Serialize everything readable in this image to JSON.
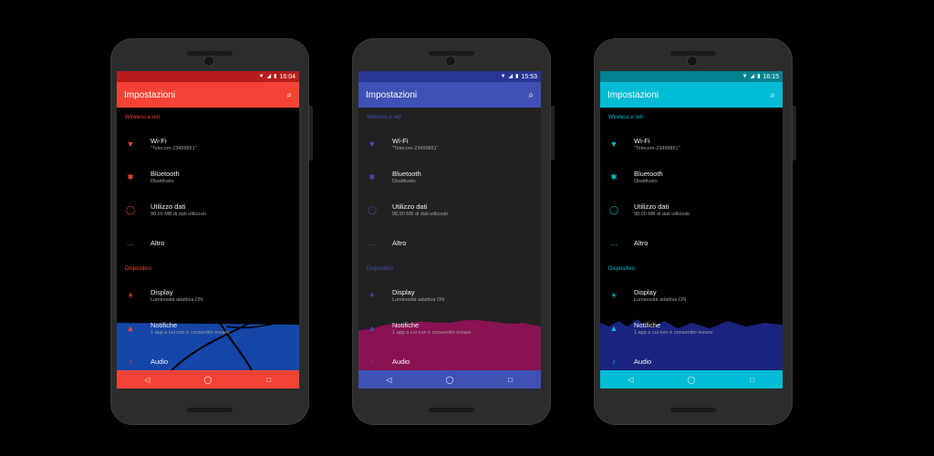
{
  "phones": [
    {
      "time": "16:04",
      "title": "Impostazioni",
      "accent": "#f44336",
      "accent_dark": "#b71c1c",
      "bg": "#000000",
      "sections": [
        "Wireless e reti",
        "Dispositivo"
      ],
      "items": [
        {
          "title": "Wi-Fi",
          "subtitle": "\"Telecom-23499851\"",
          "icon": "wifi-icon"
        },
        {
          "title": "Bluetooth",
          "subtitle": "Disattivato",
          "icon": "bluetooth-icon"
        },
        {
          "title": "Utilizzo dati",
          "subtitle": "98,90 MB di dati utilizzati",
          "icon": "data-usage-icon"
        },
        {
          "title": "Altro",
          "subtitle": "",
          "icon": "more-icon"
        },
        {
          "title": "Display",
          "subtitle": "Luminosità adattiva ON",
          "icon": "brightness-icon"
        },
        {
          "title": "Notifiche",
          "subtitle": "1 app a cui non è consentito inviare",
          "icon": "bell-icon"
        },
        {
          "title": "Audio",
          "subtitle": "",
          "icon": "audio-icon"
        }
      ],
      "wave_color": "#1546a8"
    },
    {
      "time": "15:53",
      "title": "Impostazioni",
      "accent": "#3f51b5",
      "accent_dark": "#283593",
      "bg": "#212121",
      "sections": [
        "Wireless e reti",
        "Dispositivo"
      ],
      "items": [
        {
          "title": "Wi-Fi",
          "subtitle": "\"Telecom-23499851\"",
          "icon": "wifi-icon"
        },
        {
          "title": "Bluetooth",
          "subtitle": "Disattivato",
          "icon": "bluetooth-icon"
        },
        {
          "title": "Utilizzo dati",
          "subtitle": "98,90 MB di dati utilizzati",
          "icon": "data-usage-icon"
        },
        {
          "title": "Altro",
          "subtitle": "",
          "icon": "more-icon"
        },
        {
          "title": "Display",
          "subtitle": "Luminosità adattiva ON",
          "icon": "brightness-icon"
        },
        {
          "title": "Notifiche",
          "subtitle": "1 app a cui non è consentito inviare",
          "icon": "bell-icon"
        },
        {
          "title": "Audio",
          "subtitle": "",
          "icon": "audio-icon"
        }
      ],
      "wave_color": "#8a1252"
    },
    {
      "time": "16:15",
      "title": "Impostazioni",
      "accent": "#00bcd4",
      "accent_dark": "#00838f",
      "bg": "#000000",
      "sections": [
        "Wireless e reti",
        "Dispositivo"
      ],
      "items": [
        {
          "title": "Wi-Fi",
          "subtitle": "\"Telecom-23499851\"",
          "icon": "wifi-icon"
        },
        {
          "title": "Bluetooth",
          "subtitle": "Disattivato",
          "icon": "bluetooth-icon"
        },
        {
          "title": "Utilizzo dati",
          "subtitle": "98,90 MB di dati utilizzati",
          "icon": "data-usage-icon"
        },
        {
          "title": "Altro",
          "subtitle": "",
          "icon": "more-icon"
        },
        {
          "title": "Display",
          "subtitle": "Luminosità adattiva ON",
          "icon": "brightness-icon"
        },
        {
          "title": "Notifiche",
          "subtitle": "1 app a cui non è consentito inviare",
          "icon": "bell-icon"
        },
        {
          "title": "Audio",
          "subtitle": "",
          "icon": "audio-icon"
        }
      ],
      "wave_color": "#1a237e"
    }
  ]
}
